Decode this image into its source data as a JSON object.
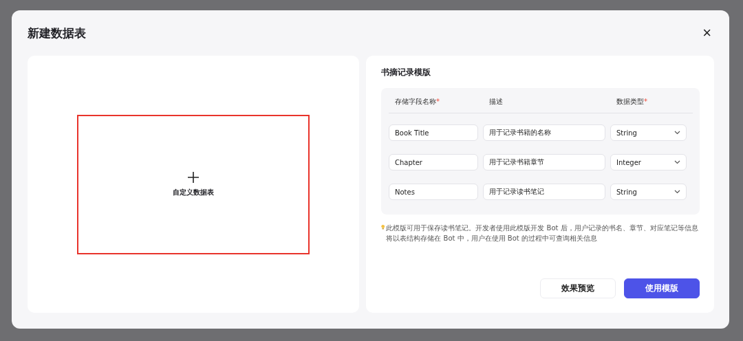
{
  "dialog": {
    "title": "新建数据表",
    "close": "×"
  },
  "custom_table": {
    "label": "自定义数据表",
    "highlighted": true
  },
  "template": {
    "title": "书摘记录模版",
    "required_mark": "*",
    "columns": [
      {
        "label": "存储字段名称",
        "required": true
      },
      {
        "label": "描述",
        "required": false
      },
      {
        "label": "数据类型",
        "required": true
      }
    ],
    "rows": [
      {
        "name": "Book Title",
        "description": "用于记录书籍的名称",
        "type": "String"
      },
      {
        "name": "Chapter",
        "description": "用于记录书籍章节",
        "type": "Integer"
      },
      {
        "name": "Notes",
        "description": "用于记录读书笔记",
        "type": "String"
      }
    ],
    "note": "此模版可用于保存读书笔记。开发者使用此模版开发 Bot 后，用户记录的书名、章节、对应笔记等信息将以表结构存储在 Bot 中，用户在使用 Bot 的过程中可查询相关信息"
  },
  "buttons": [
    {
      "label": "效果预览",
      "kind": "secondary"
    },
    {
      "label": "使用模版",
      "kind": "primary"
    }
  ]
}
